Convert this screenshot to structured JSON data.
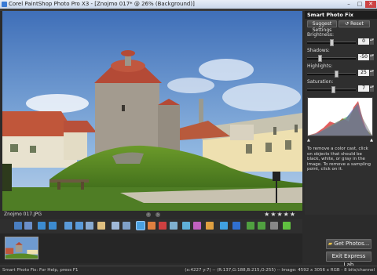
{
  "window": {
    "title": "Corel PaintShop Photo Pro X3 - [Znojmo 017* @ 26% (Background)]",
    "controls": {
      "minimize": "–",
      "maximize": "□",
      "close": "✕"
    }
  },
  "side_panel": {
    "title": "Smart Photo Fix",
    "suggest_label": "Suggest Settings",
    "reset_label": "Reset",
    "sliders": [
      {
        "label": "Brightness:",
        "value": "0",
        "level": 0.5
      },
      {
        "label": "Shadows:",
        "value": "-50",
        "level": 0.25
      },
      {
        "label": "Highlights:",
        "value": "25",
        "level": 0.62
      },
      {
        "label": "Saturation:",
        "value": "7",
        "level": 0.55
      }
    ],
    "help_text": "To remove a color cast, click on objects that should be black, white, or gray in the image. To remove a sampling point, click on it."
  },
  "image_info": {
    "filename": "Znojmo 017.JPG",
    "rating_stars": [
      "★",
      "★",
      "★",
      "★",
      "★"
    ],
    "nav_prev": "‹",
    "nav_next": "›"
  },
  "toolbar": {
    "icons": [
      "save-icon",
      "save-as-icon",
      "undo-icon",
      "redo-icon",
      "one-to-one-icon",
      "fit-icon",
      "zoom-icon",
      "pan-icon",
      "crop-straighten-icon",
      "crop-icon",
      "smart-fix-icon",
      "makeover-icon",
      "red-eye-icon",
      "straighten-icon",
      "clarify-icon",
      "color-icon",
      "dodge-icon",
      "adjust-icon",
      "blue-icon",
      "rotate-left-icon",
      "rotate-right-icon",
      "delete-icon",
      "share-icon"
    ]
  },
  "buttons": {
    "get_photos": "Get Photos...",
    "exit_lab": "Exit Express Lab"
  },
  "statusbar": {
    "left": "Smart Photo Fix: For Help, press F1",
    "right": "(x:4227 y:7) -- (R:137,G:188,B:215,O:255) -- Image: 4592 x 3056 x RGB - 8 bits/channel"
  },
  "colors": {
    "accent": "#3a7bd5",
    "panel": "#2f2f2f"
  }
}
